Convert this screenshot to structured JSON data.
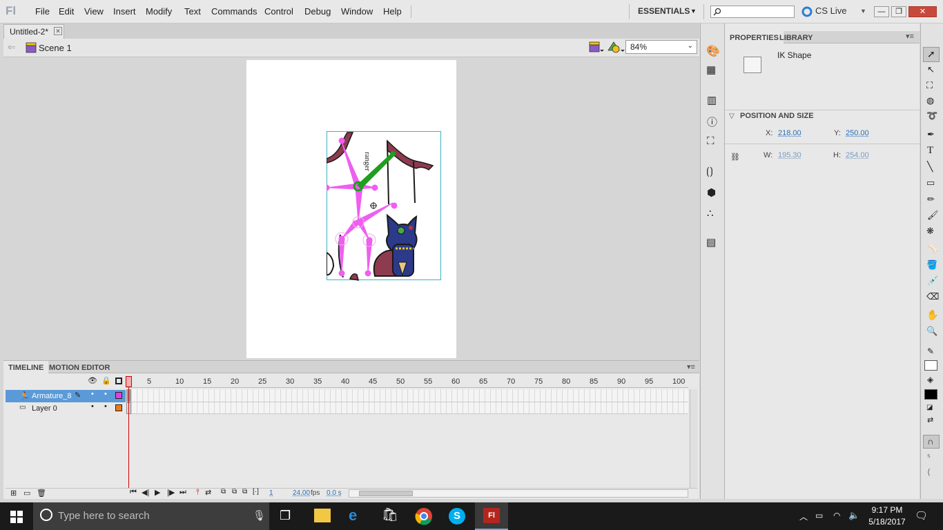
{
  "app": {
    "logo": "Fl",
    "menu": [
      "File",
      "Edit",
      "View",
      "Insert",
      "Modify",
      "Text",
      "Commands",
      "Control",
      "Debug",
      "Window",
      "Help"
    ],
    "workspace": "ESSENTIALS",
    "search_placeholder": "",
    "cslive": "CS Live"
  },
  "document": {
    "tab_title": "Untitled-2*",
    "scene": "Scene 1",
    "zoom": "84%"
  },
  "timeline": {
    "tabs": [
      "TIMELINE",
      "MOTION EDITOR"
    ],
    "frame_numbers": [
      "1",
      "5",
      "10",
      "15",
      "20",
      "25",
      "30",
      "35",
      "40",
      "45",
      "50",
      "55",
      "60",
      "65",
      "70",
      "75",
      "80",
      "85",
      "90",
      "95",
      "100"
    ],
    "layers": [
      {
        "name": "Armature_8",
        "selected": true,
        "color": "#e040e0"
      },
      {
        "name": "Layer 0",
        "selected": false,
        "color": "#ef7a1a"
      }
    ],
    "current_frame": "1",
    "fps": "24.00",
    "fps_unit": "fps",
    "time": "0.0 s"
  },
  "properties": {
    "tabs": [
      "PROPERTIES",
      "LIBRARY"
    ],
    "object_type": "IK Shape",
    "section": "POSITION AND SIZE",
    "x_label": "X:",
    "x": "218.00",
    "y_label": "Y:",
    "y": "250.00",
    "w_label": "W:",
    "w": "195.30",
    "h_label": "H:",
    "h": "254.00"
  },
  "taskbar": {
    "search_placeholder": "Type here to search",
    "time": "9:17 PM",
    "date": "5/18/2017"
  },
  "colors": {
    "bone": "#ee5ff0",
    "selected_bone": "#1f9e1f",
    "layer_selected_bg": "#5a9ad8",
    "accent": "#2a6fb8"
  }
}
